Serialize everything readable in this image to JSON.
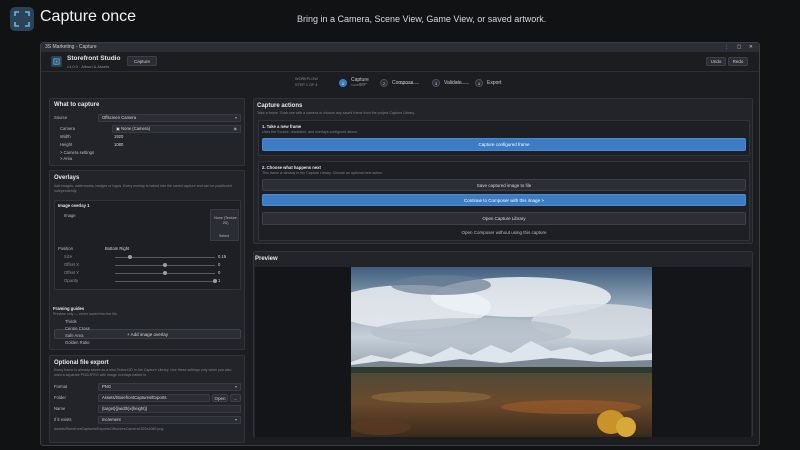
{
  "hero": {
    "title": "Capture once",
    "subtitle": "Bring in a Camera, Scene View, Game View, or saved artwork."
  },
  "window": {
    "title": "3S Marketing - Capture",
    "controls": "⋮ ▢ ✕"
  },
  "app": {
    "brand": "Storefront Studio",
    "brand_sub": "v1.0.0 · Album & Assets",
    "capture_tab": "Capture",
    "undo": "Undo",
    "redo": "Redo"
  },
  "workflow": {
    "label": "WORKFLOW",
    "step_info": "STEP 1 OF 4",
    "steps": [
      {
        "num": "1",
        "label": "Capture",
        "sub": "CURRENT"
      },
      {
        "num": "2",
        "label": "Compose",
        "sub": ""
      },
      {
        "num": "3",
        "label": "Validate",
        "sub": ""
      },
      {
        "num": "4",
        "label": "Export",
        "sub": ""
      }
    ]
  },
  "what": {
    "title": "What to capture",
    "source_label": "Source",
    "source_value": "Offscreen Camera",
    "camera_label": "Camera",
    "camera_value": "▣ None (Camera)",
    "width_label": "Width",
    "width_value": "1920",
    "height_label": "Height",
    "height_value": "1080",
    "camera_settings": "> Camera settings",
    "area": "> Area"
  },
  "overlays": {
    "title": "Overlays",
    "hint": "Add images, watermarks, badges or logos. Every overlay is baked into the saved capture and can be positioned independently.",
    "overlay_title": "Image overlay 1",
    "image_label": "Image",
    "thumb_text": "None (Texture 2D)",
    "thumb_select": "Select",
    "position_label": "Position",
    "position_value": "Bottom Right",
    "rows": [
      {
        "label": "Size",
        "value": "0.15",
        "frac": 0.15
      },
      {
        "label": "Offset X",
        "value": "0",
        "frac": 0.5
      },
      {
        "label": "Offset Y",
        "value": "0",
        "frac": 0.5
      },
      {
        "label": "Opacity",
        "value": "1",
        "frac": 1.0
      }
    ],
    "add_button": "+ Add image overlay"
  },
  "guides": {
    "title": "Framing guides",
    "hint": "Preview only — never saved into the file.",
    "items": [
      "Thirds",
      "Centre Cross",
      "Safe Area",
      "Golden Ratio"
    ]
  },
  "export": {
    "title": "Optional file export",
    "hint": "Every frame is already saved as a new Texture2D in the Capture Library. Use these settings only when you also want a separate PNG/JPEG with image overlays baked in.",
    "format_label": "Format",
    "format_value": "PNG",
    "folder_label": "Folder",
    "folder_value": "Assets/StorefrontCaptures/Exports",
    "open_button": "Open",
    "more_button": "...",
    "name_label": "Name",
    "name_value": "{target}{{width}x{height}}",
    "exists_label": "If it exists",
    "exists_value": "Increment",
    "path_preview": "Assets/StorefrontCaptures/Exports/OffscreenCamera1920x1080.png"
  },
  "actions": {
    "title": "Capture actions",
    "hint": "Take a frame. Grab one with a camera or choose any saved frame from the project Capture Library.",
    "take_title": "1. Take a new frame",
    "take_hint": "Uses the Source, resolution, and overlays configured above.",
    "capture_button": "Capture configured frame",
    "next_title": "2. Choose what happens next",
    "next_hint": "This frame is already in the Capture Library. Choose an optional next action.",
    "save_button": "Save captured image to file",
    "continue_button": "Continue to Composer with this image  >",
    "library_button": "Open Capture Library",
    "composer_link": "Open Composer without using this capture"
  },
  "preview": {
    "title": "Preview"
  }
}
